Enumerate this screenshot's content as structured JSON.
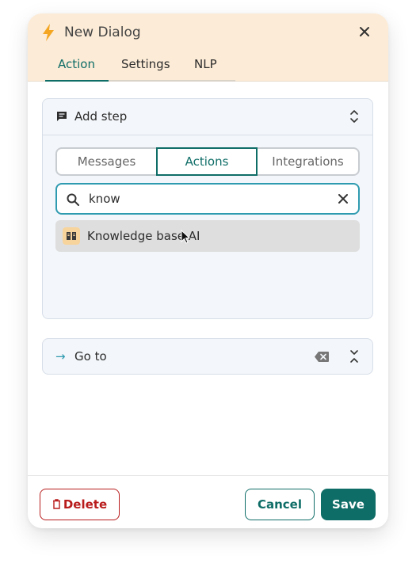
{
  "dialog": {
    "title": "New Dialog",
    "tabs": [
      "Action",
      "Settings",
      "NLP"
    ],
    "active_tab": "Action"
  },
  "add_step": {
    "title": "Add step",
    "segments": [
      "Messages",
      "Actions",
      "Integrations"
    ],
    "active_segment": "Actions",
    "search_value": "know",
    "results": [
      {
        "label": "Knowledge base AI",
        "icon": "book-icon"
      }
    ]
  },
  "goto": {
    "arrow": "→",
    "title": "Go to"
  },
  "footer": {
    "delete_label": "Delete",
    "cancel_label": "Cancel",
    "save_label": "Save"
  },
  "colors": {
    "accent": "#0f6d67",
    "header_bg": "#fcebd6",
    "danger": "#b91c1c",
    "search_border": "#2f9bb0"
  }
}
